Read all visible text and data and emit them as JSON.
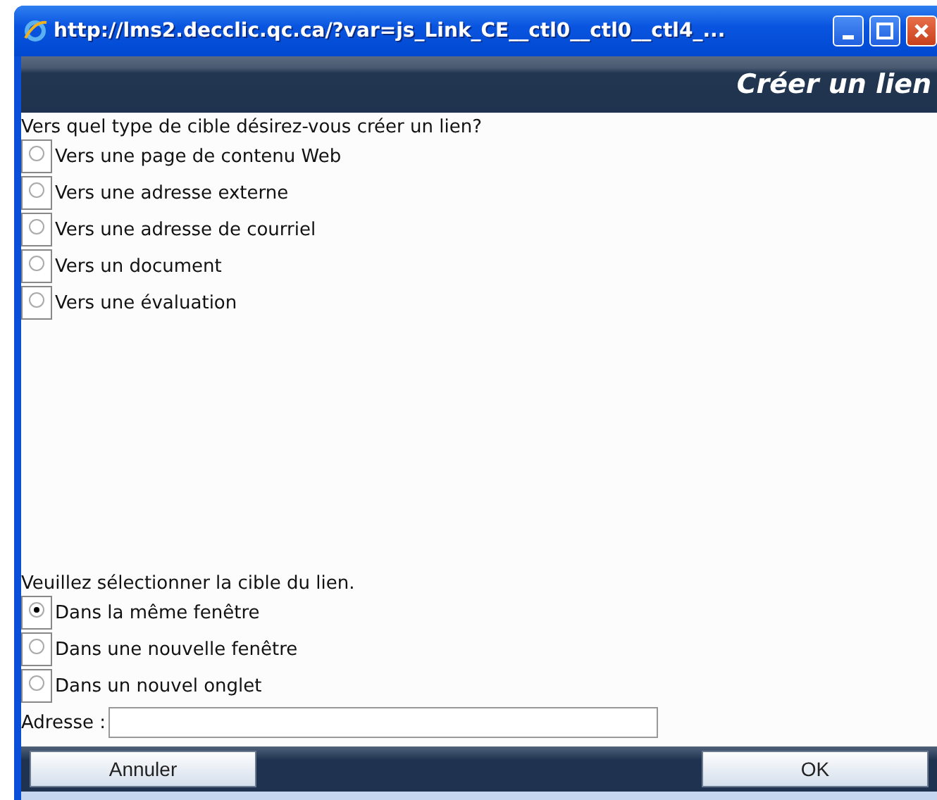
{
  "window": {
    "title": "http://lms2.decclic.qc.ca/?var=js_Link_CE__ctl0__ctl0__ctl4_..."
  },
  "header": {
    "title": "Créer un lien"
  },
  "target_type": {
    "question": "Vers quel type de cible désirez-vous créer un lien?",
    "options": [
      {
        "label": "Vers une page de contenu Web",
        "selected": false
      },
      {
        "label": "Vers une adresse externe",
        "selected": false
      },
      {
        "label": "Vers une adresse de courriel",
        "selected": false
      },
      {
        "label": "Vers un document",
        "selected": false
      },
      {
        "label": "Vers une évaluation",
        "selected": false
      }
    ]
  },
  "target_window": {
    "question": "Veuillez sélectionner la cible du lien.",
    "options": [
      {
        "label": "Dans la même fenêtre",
        "selected": true
      },
      {
        "label": "Dans une nouvelle fenêtre",
        "selected": false
      },
      {
        "label": "Dans un nouvel onglet",
        "selected": false
      }
    ]
  },
  "address": {
    "label": "Adresse :"
  },
  "buttons": [
    {
      "label": "Annuler"
    },
    {
      "label": "OK"
    }
  ]
}
